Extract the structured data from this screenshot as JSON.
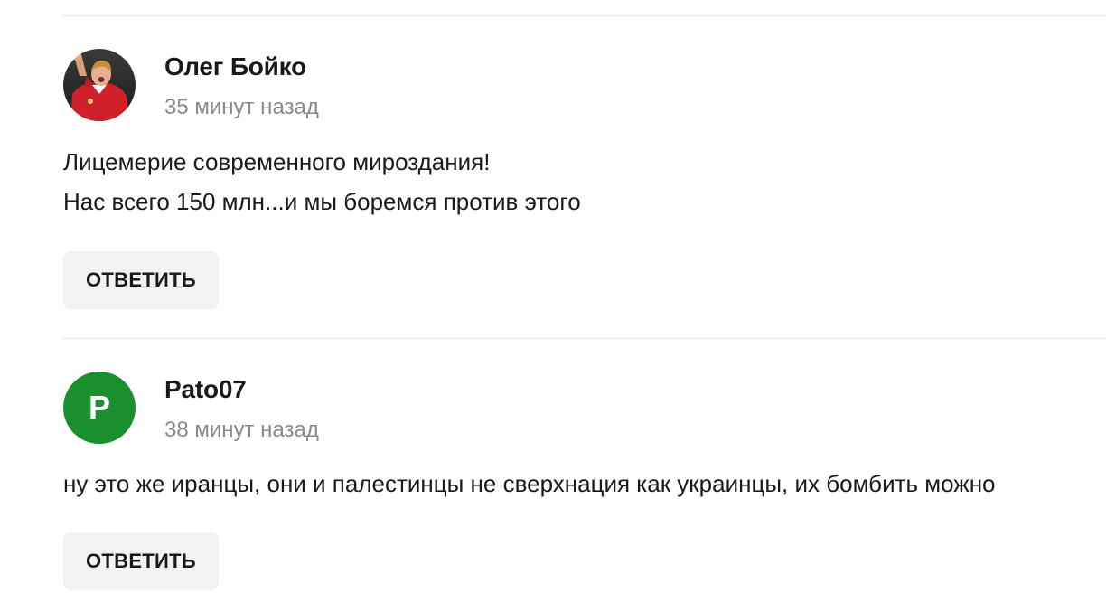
{
  "comments": [
    {
      "author": "Олег Бойко",
      "time": "35 минут назад",
      "avatar_type": "photo",
      "lines": [
        "Лицемерие современного мироздания!",
        "Нас всего 150 млн...и мы боремся против этого"
      ],
      "reply_label": "ОТВЕТИТЬ"
    },
    {
      "author": "Pato07",
      "time": "38 минут назад",
      "avatar_type": "letter",
      "avatar_letter": "P",
      "avatar_color": "#1a8f2e",
      "lines": [
        "ну это же иранцы, они и палестинцы не сверхнация как украинцы, их бомбить можно"
      ],
      "reply_label": "ОТВЕТИТЬ"
    }
  ],
  "colors": {
    "divider": "#e6e6e6",
    "time_text": "#8a8a8a",
    "button_bg": "#f2f2f2"
  }
}
